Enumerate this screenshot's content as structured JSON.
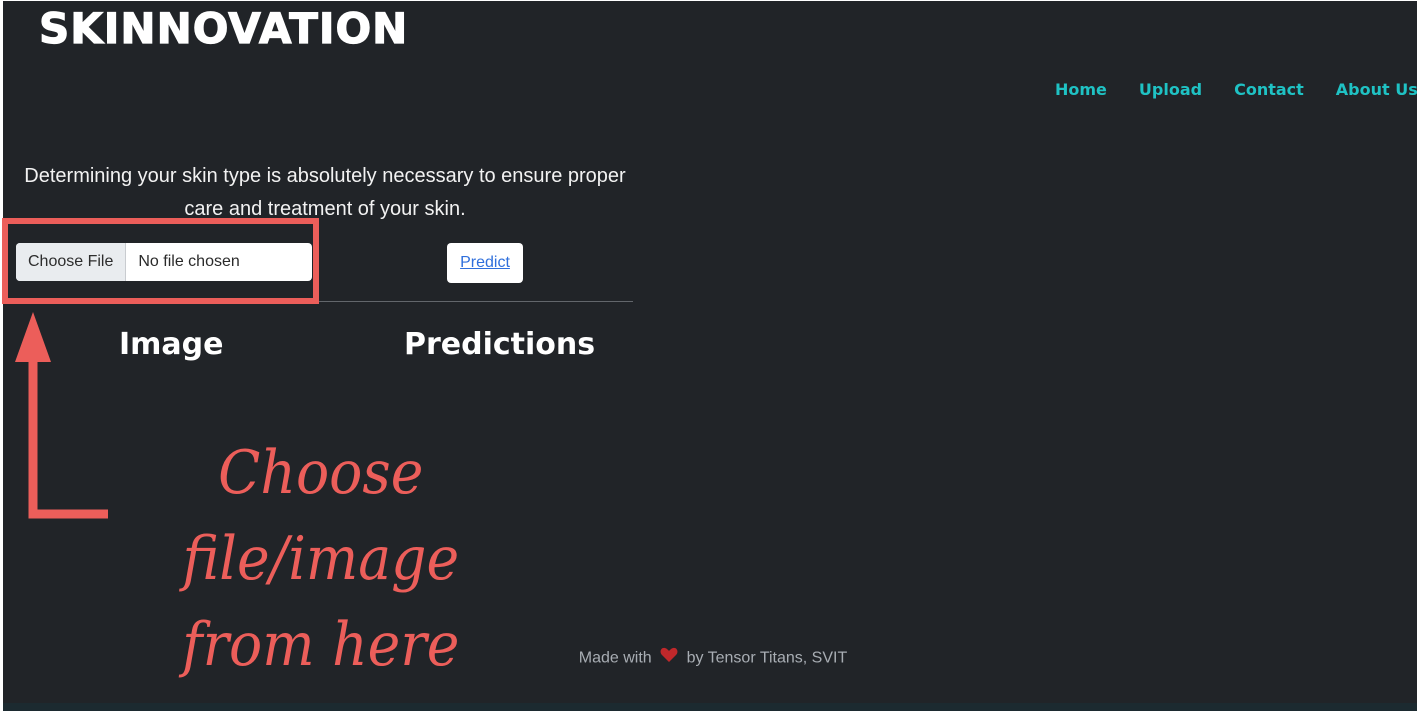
{
  "brand": {
    "name": "SKINNOVATION"
  },
  "nav": {
    "items": [
      "Home",
      "Upload",
      "Contact",
      "About Us"
    ]
  },
  "main": {
    "intro": "Determining your skin type is absolutely necessary to ensure proper care and treatment of your skin.",
    "file_input": {
      "button_label": "Choose File",
      "status": "No file chosen"
    },
    "predict_label": "Predict",
    "columns": {
      "image": "Image",
      "predictions": "Predictions"
    }
  },
  "annotation": {
    "line1": "Choose file/image",
    "line2": "from here",
    "color": "#ec5e5a"
  },
  "footer": {
    "prefix": "Made with",
    "icon": "heart-icon",
    "suffix": "by Tensor Titans, SVIT"
  },
  "colors": {
    "background": "#212428",
    "nav_link": "#1fc2c4",
    "annotation": "#ec5e5a",
    "heart": "#c0282b"
  }
}
